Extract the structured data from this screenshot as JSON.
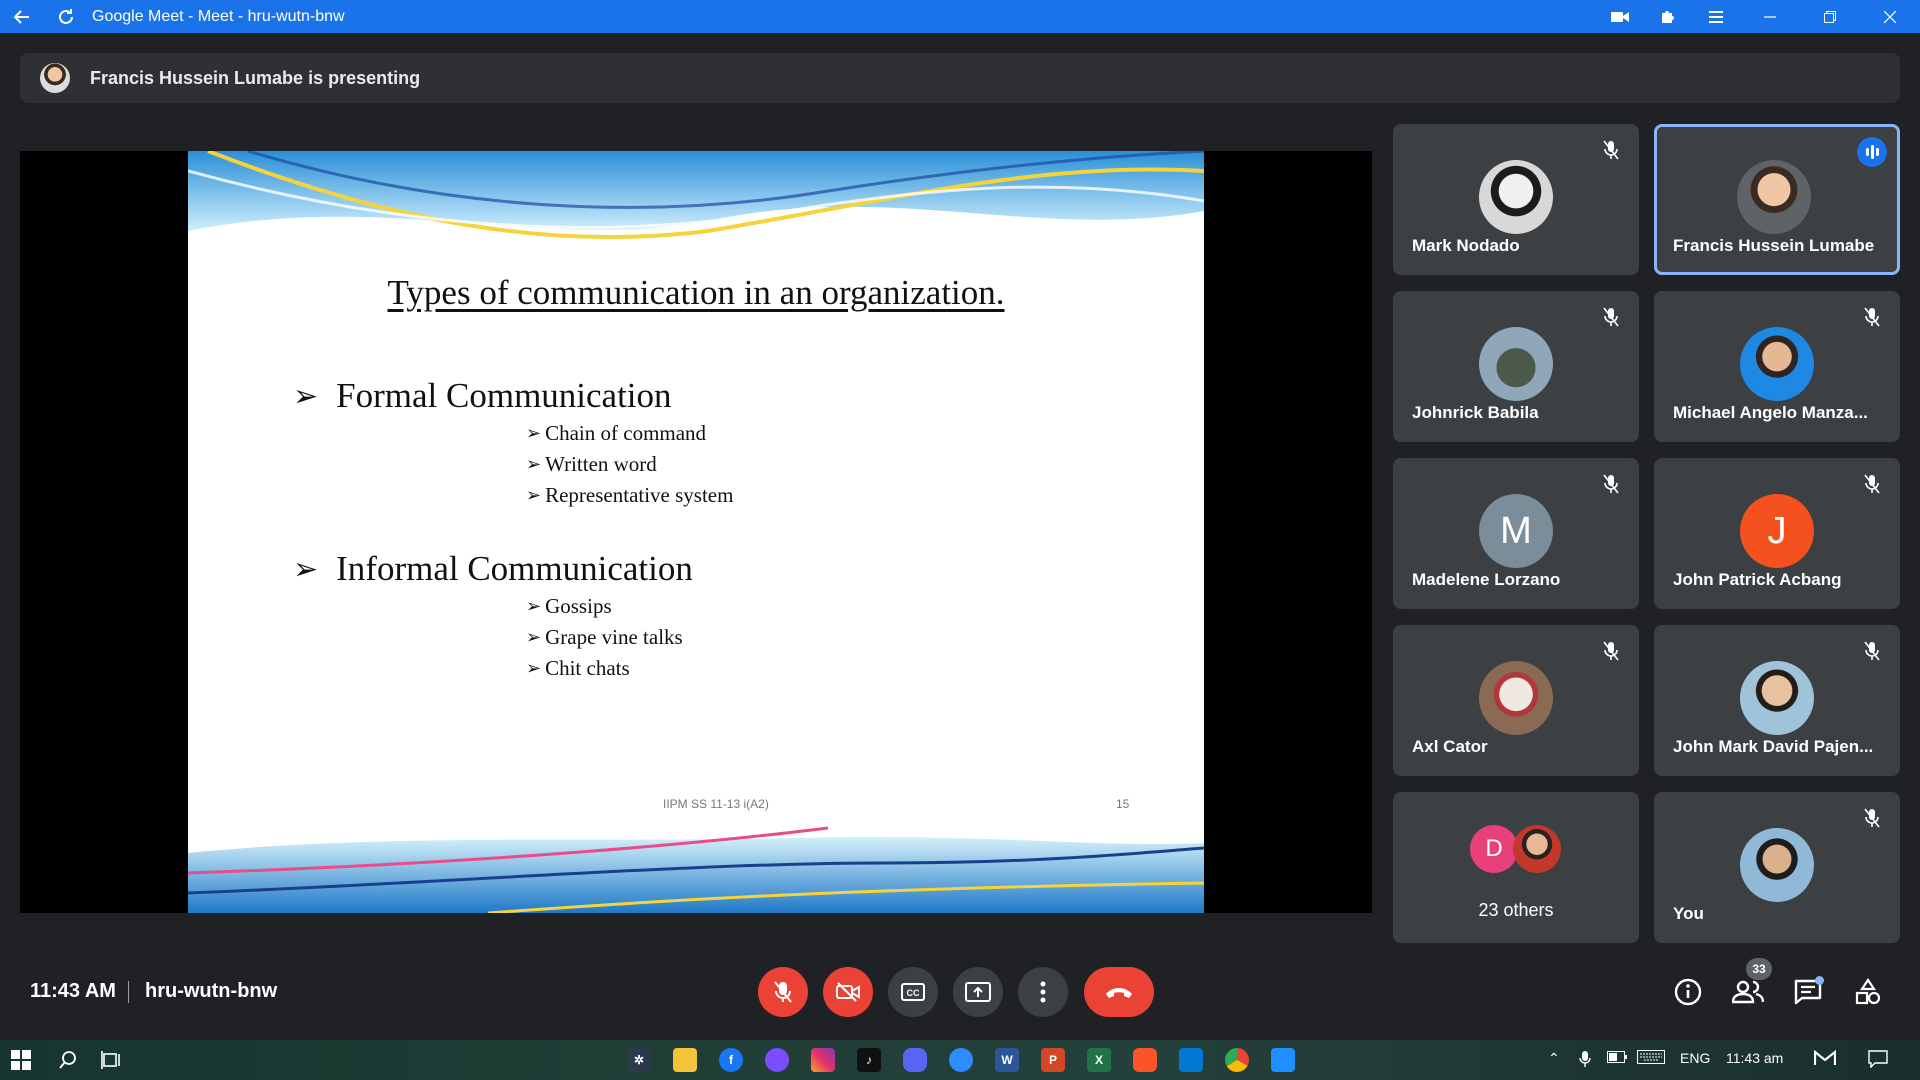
{
  "browser": {
    "title": "Google Meet - Meet - hru-wutn-bnw"
  },
  "banner": {
    "text": "Francis Hussein Lumabe is presenting"
  },
  "slide": {
    "title": "Types of communication in an organization.",
    "sections": [
      {
        "heading": "Formal Communication",
        "items": [
          "Chain of command",
          "Written word",
          "Representative system"
        ]
      },
      {
        "heading": "Informal Communication",
        "items": [
          "Gossips",
          "Grape vine talks",
          "Chit chats"
        ]
      }
    ],
    "footer_left": "IIPM SS 11-13 i(A2)",
    "page_number": "15",
    "bullet_glyph": "➢"
  },
  "participants": [
    {
      "name": "Mark Nodado",
      "muted": true
    },
    {
      "name": "Francis Hussein Lumabe",
      "muted": false,
      "speaking": true,
      "presenting": true
    },
    {
      "name": "Johnrick Babila",
      "muted": true
    },
    {
      "name": "Michael Angelo Manza...",
      "muted": true
    },
    {
      "name": "Madelene Lorzano",
      "muted": true,
      "initial": "M",
      "color": "#7b8d99"
    },
    {
      "name": "John Patrick Acbang",
      "muted": true,
      "initial": "J",
      "color": "#f4511e"
    },
    {
      "name": "Axl Cator",
      "muted": true
    },
    {
      "name": "John Mark David Pajen...",
      "muted": true
    },
    {
      "name": "23 others",
      "initial": "D",
      "color": "#e8407a"
    },
    {
      "name": "You",
      "muted": true
    }
  ],
  "footer": {
    "time": "11:43 AM",
    "meeting_code": "hru-wutn-bnw",
    "participant_count": "33"
  },
  "taskbar": {
    "language": "ENG",
    "time": "11:43 am"
  },
  "colors": {
    "accent": "#1a73e8",
    "danger": "#ea4335",
    "tile_bg": "#3c4043",
    "page_bg": "#202124"
  }
}
